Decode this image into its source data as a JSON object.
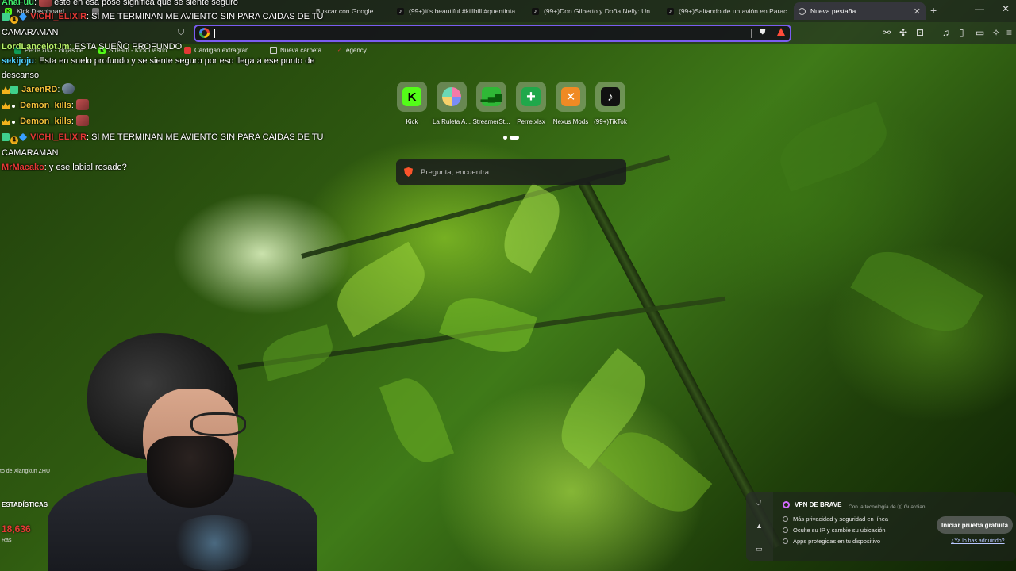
{
  "browser": {
    "tabs": [
      {
        "label": "Kick Dashboard",
        "icon": "kick-icon"
      },
      {
        "label": "",
        "icon": "page-icon"
      },
      {
        "label": "Buscar con Google",
        "icon": "google-icon"
      },
      {
        "label": "(99+)it's beautiful #killbill #quentinta",
        "icon": "tiktok-icon"
      },
      {
        "label": "(99+)Don Gilberto y Doña Nelly: Un",
        "icon": "tiktok-icon"
      },
      {
        "label": "(99+)Saltando de un avión en Parac",
        "icon": "tiktok-icon"
      },
      {
        "label": "Nueva pestaña",
        "icon": "brave-icon",
        "active": true
      }
    ],
    "new_tab_symbol": "+",
    "window_controls": {
      "minimize": "—",
      "maximize": "▢",
      "close": "✕"
    },
    "omnibox": {
      "value": "",
      "placeholder": ""
    },
    "bookmarks": [
      {
        "label": "Perre.xlsx - Hojas de...",
        "icon": "sheets-icon",
        "color": "#0f9d58"
      },
      {
        "label": "Stream - Kick Dashb...",
        "icon": "kick-icon",
        "color": "#53fc18"
      },
      {
        "label": "Cárdigan extragran...",
        "icon": "shop-icon",
        "color": "#e53935"
      },
      {
        "label": "Nueva carpeta",
        "icon": "folder-icon",
        "color": "#cfcfcf"
      },
      {
        "label": "egency",
        "icon": "egency-icon",
        "color": "#e53935"
      }
    ]
  },
  "new_tab": {
    "shortcuts": [
      {
        "label": "Kick",
        "glyph": "K",
        "bg": "#53fc18",
        "fg": "#000"
      },
      {
        "label": "La Ruleta A...",
        "glyph": "●",
        "bg": "#f1b6e0",
        "fg": "#5a6cf0"
      },
      {
        "label": "StreamerSt...",
        "glyph": "▮",
        "bg": "#3ad13a",
        "fg": "#0a5a0a"
      },
      {
        "label": "Perre.xlsx",
        "glyph": "+",
        "bg": "#20a84a",
        "fg": "#fff"
      },
      {
        "label": "Nexus Mods",
        "glyph": "✕",
        "bg": "#f08a24",
        "fg": "#fff"
      },
      {
        "label": "(99+)TikTok",
        "glyph": "♪",
        "bg": "#111",
        "fg": "#fff"
      }
    ],
    "search_placeholder": "Pregunta, encuentra...",
    "photo_credit": "to de Xiangkun ZHU"
  },
  "chat": [
    {
      "user": "AnaFuu",
      "color": "#3fe86a",
      "text": "este en esa pose significa que se siente seguro",
      "partial": true
    },
    {
      "user": "VICHI_ELIXIR",
      "color": "#e53935",
      "badges": [
        "gift",
        "one",
        "gem"
      ],
      "text": "SI ME TERMINAN ME AVIENTO SIN PARA CAIDAS DE TU CAMARAMAN"
    },
    {
      "user": "LordLancelotJm",
      "color": "#b9f26a",
      "text": "ESTA SUEÑO PROFUNDO"
    },
    {
      "user": "sekijoju",
      "color": "#4fd0ff",
      "text": "Esta en suelo profundo y se siente seguro por eso llega a ese punto de descanso"
    },
    {
      "user": "JarenRD",
      "color": "#f6c33b",
      "badges": [
        "crown",
        "gift"
      ],
      "emote": "round"
    },
    {
      "user": "Demon_kills",
      "color": "#f6c33b",
      "badges": [
        "crown",
        "dot"
      ],
      "emote": "square"
    },
    {
      "user": "Demon_kills",
      "color": "#f6c33b",
      "badges": [
        "crown",
        "dot"
      ],
      "emote": "square"
    },
    {
      "user": "VICHI_ELIXIR",
      "color": "#e53935",
      "badges": [
        "gift",
        "one",
        "gem"
      ],
      "text": "SI ME TERMINAN ME AVIENTO SIN PARA CAIDAS DE TU CAMARAMAN"
    },
    {
      "user": "MrMacako",
      "color": "#e53935",
      "text": "y ese labial rosado?"
    }
  ],
  "stats": {
    "title": "ESTADÍSTICAS",
    "value": "18,636",
    "sub": "Ras"
  },
  "vpn": {
    "title": "VPN DE BRAVE",
    "powered": "Con la tecnología de ⓖ Guardian",
    "features": [
      "Más privacidad y seguridad en línea",
      "Oculte su IP y cambie su ubicación",
      "Apps protegidas en tu dispositivo"
    ],
    "cta": "Iniciar prueba gratuita",
    "link": "¿Ya lo has adquirido?"
  }
}
